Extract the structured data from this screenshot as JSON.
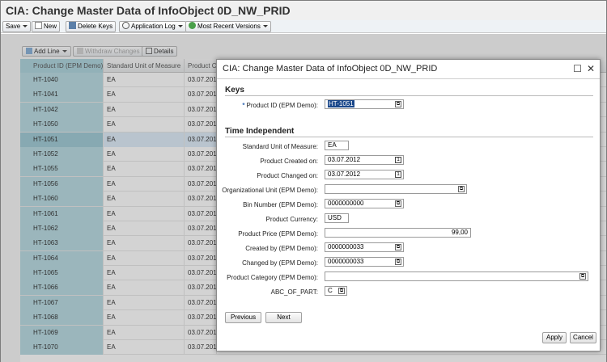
{
  "app": {
    "title": "CIA: Change Master Data of InfoObject 0D_NW_PRID"
  },
  "toolbar": {
    "save": "Save",
    "new": "New",
    "delete_keys": "Delete Keys",
    "application_log": "Application Log",
    "most_recent_versions": "Most Recent Versions"
  },
  "table_toolbar": {
    "add_line": "Add Line",
    "withdraw_changes": "Withdraw Changes",
    "details": "Details"
  },
  "table": {
    "columns": [
      "Product ID (EPM Demo)",
      "Standard Unit of Measure",
      "Product C"
    ],
    "rows": [
      [
        "HT-1040",
        "EA",
        "03.07.201"
      ],
      [
        "HT-1041",
        "EA",
        "03.07.201"
      ],
      [
        "HT-1042",
        "EA",
        "03.07.201"
      ],
      [
        "HT-1050",
        "EA",
        "03.07.201"
      ],
      [
        "HT-1051",
        "EA",
        "03.07.201"
      ],
      [
        "HT-1052",
        "EA",
        "03.07.201"
      ],
      [
        "HT-1055",
        "EA",
        "03.07.201"
      ],
      [
        "HT-1056",
        "EA",
        "03.07.201"
      ],
      [
        "HT-1060",
        "EA",
        "03.07.201"
      ],
      [
        "HT-1061",
        "EA",
        "03.07.201"
      ],
      [
        "HT-1062",
        "EA",
        "03.07.201"
      ],
      [
        "HT-1063",
        "EA",
        "03.07.201"
      ],
      [
        "HT-1064",
        "EA",
        "03.07.201"
      ],
      [
        "HT-1065",
        "EA",
        "03.07.201"
      ],
      [
        "HT-1066",
        "EA",
        "03.07.201"
      ],
      [
        "HT-1067",
        "EA",
        "03.07.201"
      ],
      [
        "HT-1068",
        "EA",
        "03.07.201"
      ],
      [
        "HT-1069",
        "EA",
        "03.07.201"
      ],
      [
        "HT-1070",
        "EA",
        "03.07.201"
      ]
    ],
    "selected_row": "HT-1051"
  },
  "dialog": {
    "title": "CIA: Change Master Data of InfoObject 0D_NW_PRID",
    "keys_section": "Keys",
    "time_independent_section": "Time Independent",
    "fields": {
      "product_id": {
        "label": "Product ID (EPM Demo):",
        "value": "HT-1051"
      },
      "std_uom": {
        "label": "Standard Unit of Measure:",
        "value": "EA"
      },
      "created_on": {
        "label": "Product Created on:",
        "value": "03.07.2012"
      },
      "changed_on": {
        "label": "Product Changed on:",
        "value": "03.07.2012"
      },
      "org_unit": {
        "label": "Organizational Unit (EPM Demo):",
        "value": ""
      },
      "bin_number": {
        "label": "Bin Number (EPM Demo):",
        "value": "0000000000"
      },
      "currency": {
        "label": "Product Currency:",
        "value": "USD"
      },
      "price": {
        "label": "Product Price (EPM Demo):",
        "value": "99,00"
      },
      "created_by": {
        "label": "Created by (EPM Demo):",
        "value": "0000000033"
      },
      "changed_by": {
        "label": "Changed by (EPM Demo):",
        "value": "0000000033"
      },
      "category": {
        "label": "Product Category (EPM Demo):",
        "value": ""
      },
      "abc": {
        "label": "ABC_OF_PART:",
        "value": "C"
      }
    },
    "buttons": {
      "previous": "Previous",
      "next": "Next",
      "apply": "Apply",
      "cancel": "Cancel"
    },
    "required_marker": "*"
  }
}
